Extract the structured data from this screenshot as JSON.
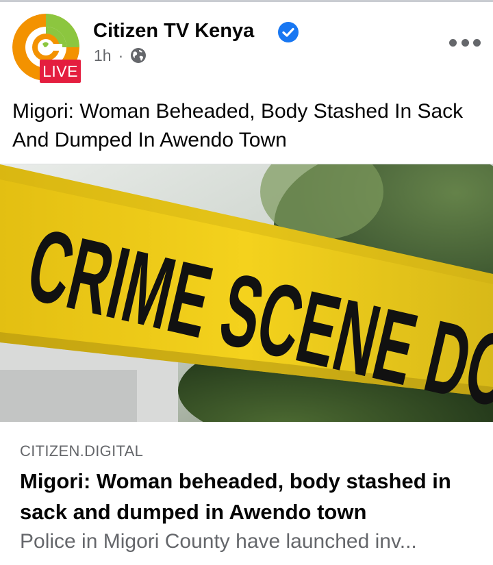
{
  "post": {
    "page_name": "Citizen TV Kenya",
    "live_badge": "LIVE",
    "time": "1h",
    "separator": "·",
    "caption": "Migori: Woman Beheaded, Body Stashed In Sack And Dumped In Awendo Town",
    "image": {
      "tape_text": "CRIME SCENE DO NOT CROSS",
      "tape_color": "#f4d21d"
    }
  },
  "link_preview": {
    "domain": "CITIZEN.DIGITAL",
    "title": "Migori: Woman beheaded, body stashed in sack and dumped in Awendo town",
    "description": "Police in Migori County have launched inv..."
  },
  "icons": {
    "verified": "verified-badge-icon",
    "audience": "globe-icon",
    "more": "more-options-icon"
  },
  "colors": {
    "verified_blue": "#1877f2",
    "live_red": "#e41e3f",
    "logo_orange": "#f39200",
    "logo_green": "#8cc63f"
  }
}
